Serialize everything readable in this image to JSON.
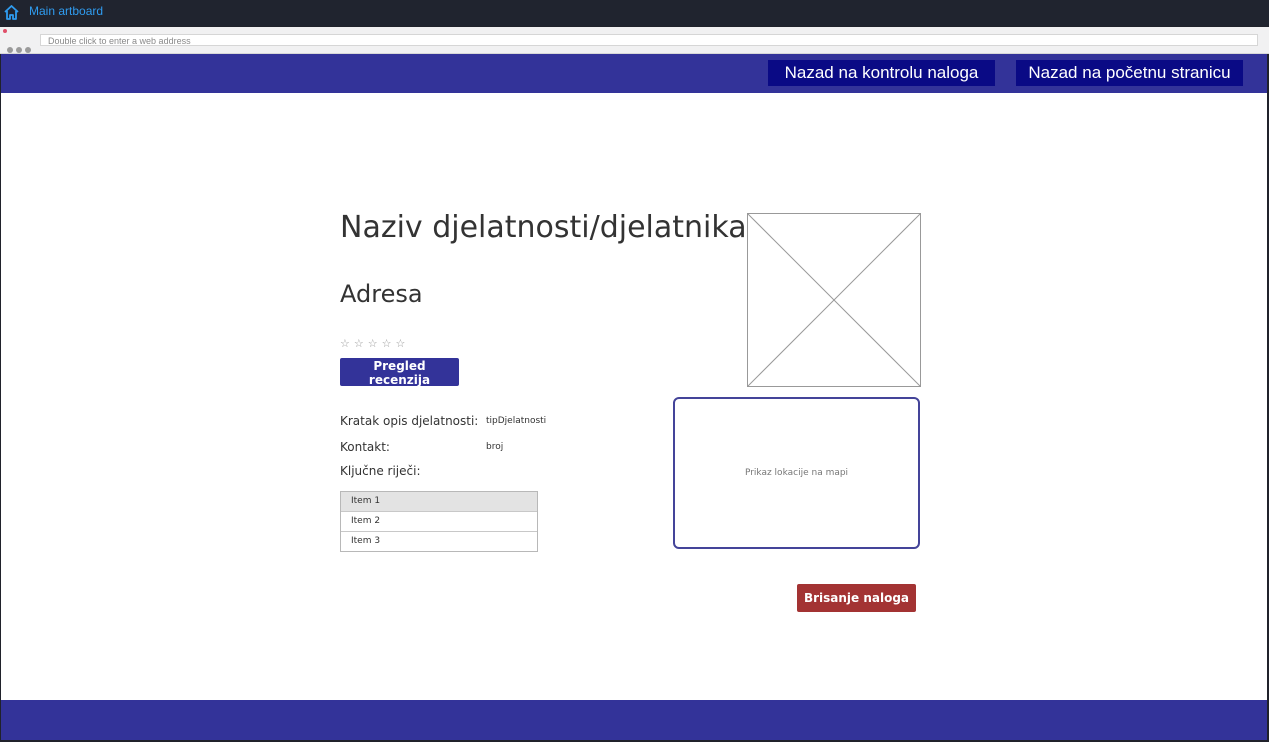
{
  "app": {
    "title": "Main artboard",
    "address_placeholder": "Double click to enter a web address"
  },
  "nav": {
    "account_control_label": "Nazad na kontrolu naloga",
    "home_label": "Nazad na početnu stranicu"
  },
  "profile": {
    "title": "Naziv djelatnosti/djelatnika",
    "address": "Adresa",
    "rating": {
      "stars": "☆☆☆☆☆",
      "value": 0,
      "max": 5
    },
    "reviews_button": "Pregled recenzija",
    "description_label": "Kratak opis djelatnosti:",
    "description_value": "tipDjelatnosti",
    "contact_label": "Kontakt:",
    "contact_value": "broj",
    "keywords_label": "Ključne riječi:",
    "keywords": [
      "Item 1",
      "Item 2",
      "Item 3"
    ],
    "map_text": "Prikaz lokacije na mapi",
    "delete_button": "Brisanje naloga"
  },
  "colors": {
    "brand": "#333399",
    "nav_button": "#0a0a85",
    "danger": "#a33333",
    "link": "#2f9cf0"
  }
}
